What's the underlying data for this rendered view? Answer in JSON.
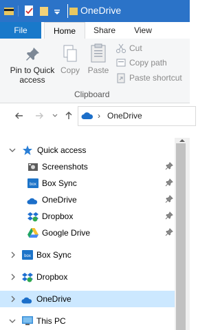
{
  "window": {
    "title": "OneDrive"
  },
  "ribbon": {
    "tabs": {
      "file": "File",
      "home": "Home",
      "share": "Share",
      "view": "View"
    },
    "pin_label_1": "Pin to Quick",
    "pin_label_2": "access",
    "copy_label": "Copy",
    "paste_label": "Paste",
    "cut_label": "Cut",
    "copy_path_label": "Copy path",
    "paste_shortcut_label": "Paste shortcut",
    "group_label": "Clipboard"
  },
  "address": {
    "crumb": "OneDrive"
  },
  "tree": {
    "quick_access": "Quick access",
    "quick_items": [
      "Screenshots",
      "Box Sync",
      "OneDrive",
      "Dropbox",
      "Google Drive"
    ],
    "box_sync": "Box Sync",
    "dropbox": "Dropbox",
    "onedrive": "OneDrive",
    "this_pc": "This PC"
  },
  "colors": {
    "titlebar": "#2b73c8",
    "file_tab": "#1979ca",
    "selection": "#cce8ff"
  }
}
